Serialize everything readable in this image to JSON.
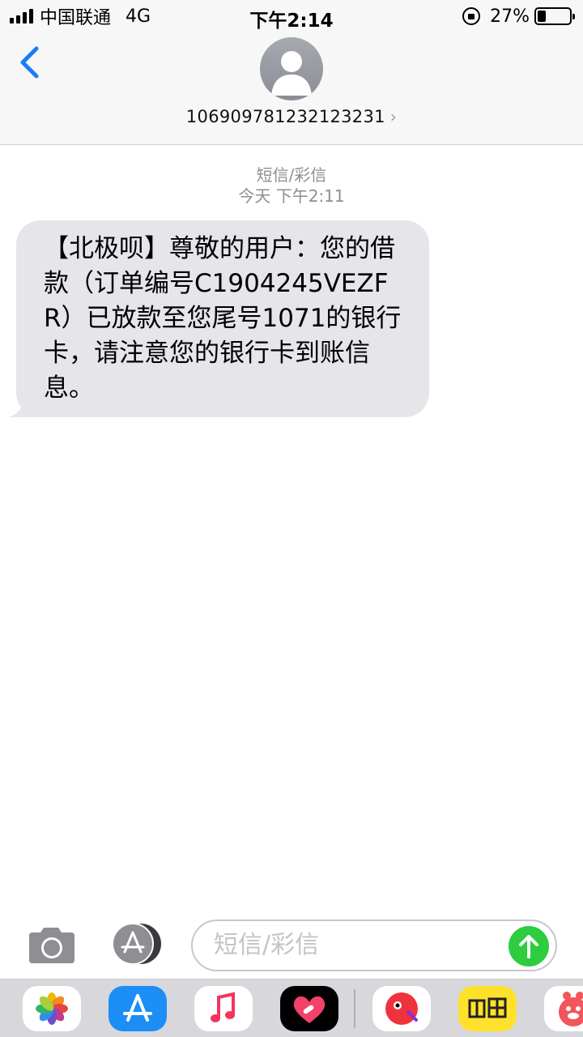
{
  "status_bar": {
    "carrier": "中国联通",
    "network": "4G",
    "time": "下午2:14",
    "battery_percent": "27%",
    "battery_level": 0.27
  },
  "header": {
    "contact_number": "106909781232123231",
    "back_icon": "chevron-left-icon",
    "avatar_icon": "person-silhouette-icon"
  },
  "conversation": {
    "service_label": "短信/彩信",
    "timestamp": "今天 下午2:11",
    "messages": [
      {
        "direction": "incoming",
        "text": "【北极呗】尊敬的用户：您的借款（订单编号C1904245VEZFR）已放款至您尾号1071的银行卡，请注意您的银行卡到账信息。"
      }
    ]
  },
  "input_bar": {
    "placeholder": "短信/彩信",
    "camera_icon": "camera-icon",
    "apps_icon": "app-store-icon",
    "send_icon": "send-arrow-icon",
    "send_color": "#2ecc3f"
  },
  "app_tray": {
    "apps": [
      "photos-icon",
      "app-store-icon",
      "music-icon",
      "heart-app-icon",
      "tmall-icon",
      "xianyu-icon",
      "pig-app-icon"
    ]
  },
  "colors": {
    "accent": "#1a7cf5",
    "bubble_incoming": "#e5e5ea",
    "meta_gray": "#8e8e93"
  }
}
